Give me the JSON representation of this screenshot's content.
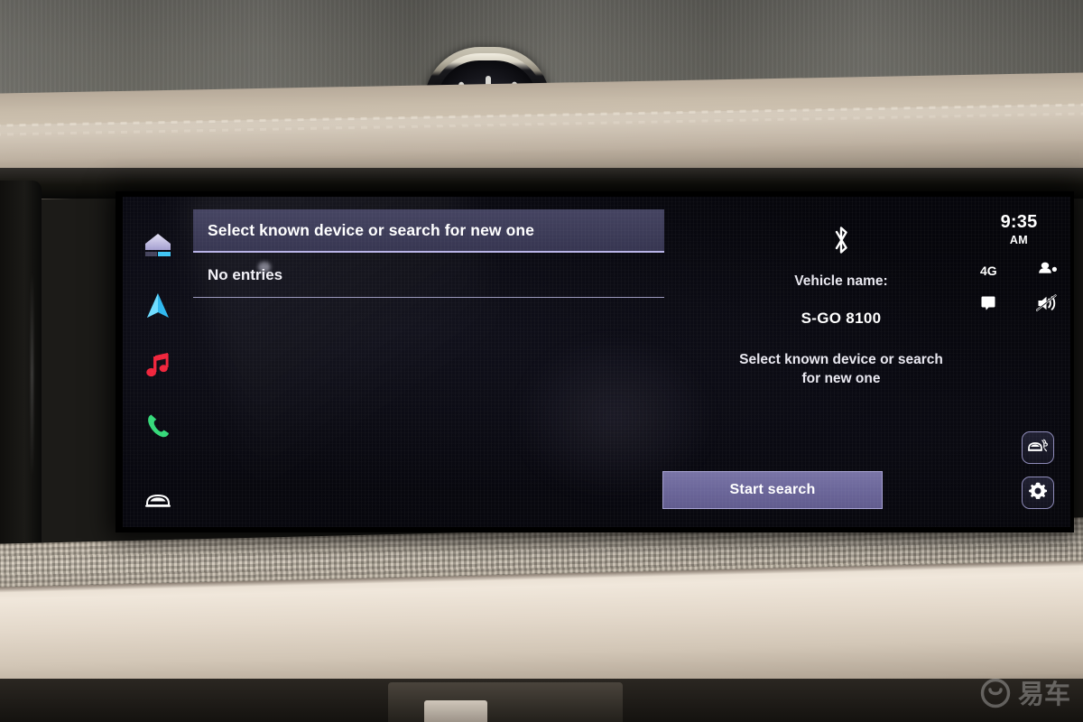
{
  "photo": {
    "scene": "car-dashboard-interior",
    "watermark": {
      "text": "易车",
      "logo_icon": "yiche-circle-logo"
    }
  },
  "screen": {
    "sidebar": {
      "items": [
        {
          "id": "home",
          "label": "Home",
          "icon": "home-icon",
          "color": "#c8c4e8"
        },
        {
          "id": "nav",
          "label": "Navigation",
          "icon": "navigation-arrow-icon",
          "color": "#3fc6f5"
        },
        {
          "id": "media",
          "label": "Media",
          "icon": "music-note-icon",
          "color": "#f0253c"
        },
        {
          "id": "phone",
          "label": "Phone",
          "icon": "phone-handset-icon",
          "color": "#35d97a"
        },
        {
          "id": "car",
          "label": "Vehicle",
          "icon": "car-front-icon",
          "color": "#ffffff"
        }
      ]
    },
    "device_list": {
      "header": "Select known device or search for new one",
      "rows": [
        "No entries"
      ]
    },
    "bluetooth_panel": {
      "bt_icon": "bluetooth-icon",
      "vehicle_name_label": "Vehicle name:",
      "vehicle_name_value": "S-GO 8100",
      "hint": "Select known device or search for new one"
    },
    "status_bar": {
      "time": "9:35",
      "meridiem": "AM",
      "network": "4G",
      "profile_icon": "user-profile-icon",
      "message_icon": "message-square-icon",
      "volume_icon": "volume-muted-icon"
    },
    "actions": {
      "start_search_label": "Start search",
      "park_assist_icon": "park-assist-icon",
      "settings_icon": "gear-icon"
    },
    "colors": {
      "accent_underline": "#b9b4e8",
      "button_fill": "#6c679a",
      "header_fill": "#4a4968",
      "screen_bg": "#07070d"
    }
  }
}
